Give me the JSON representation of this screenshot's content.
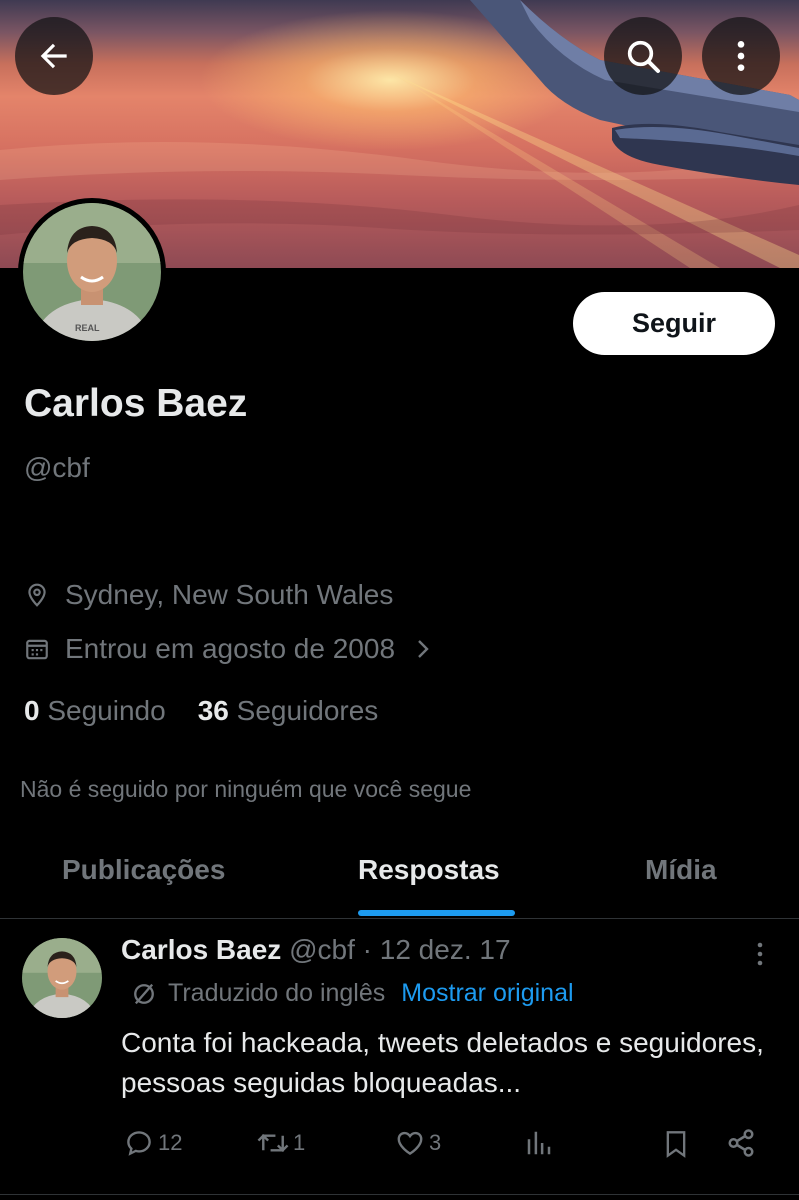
{
  "header": {
    "back_icon": "arrow-left-icon",
    "search_icon": "search-icon",
    "more_icon": "more-vertical-icon"
  },
  "profile": {
    "name": "Carlos Baez",
    "handle": "@cbf",
    "follow_label": "Seguir",
    "location": "Sydney, New South Wales",
    "joined": "Entrou em agosto de 2008",
    "following_count": "0",
    "following_label": "Seguindo",
    "followers_count": "36",
    "followers_label": "Seguidores",
    "not_followed_text": "Não é seguido por ninguém que você segue"
  },
  "tabs": [
    {
      "label": "Publicações",
      "active": false
    },
    {
      "label": "Respostas",
      "active": true
    },
    {
      "label": "Mídia",
      "active": false
    }
  ],
  "tweet": {
    "author_name": "Carlos Baez",
    "author_handle": "@cbf",
    "separator": "·",
    "date": "12 dez. 17",
    "translated_label": "Traduzido do inglês",
    "show_original_label": "Mostrar original",
    "text": "Conta foi hackeada, tweets deletados e seguidores, pessoas seguidas bloqueadas...",
    "replies": "12",
    "retweets": "1",
    "likes": "3"
  },
  "colors": {
    "background": "#000000",
    "text_primary": "#e7e9ea",
    "text_secondary": "#71767b",
    "accent": "#1d9bf0",
    "divider": "#2f3336"
  }
}
